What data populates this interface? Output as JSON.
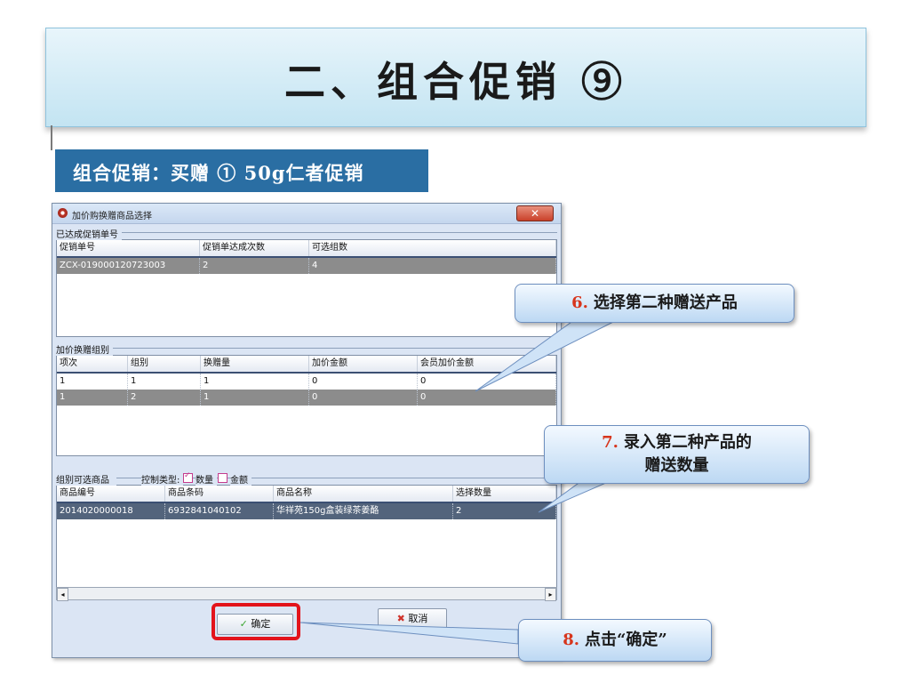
{
  "slide": {
    "title": "二、组合促销 ⑨",
    "subtitle": "组合促销：买赠 ① 50g仁者促销"
  },
  "dialog": {
    "title": "加价购换赠商品选择",
    "close_icon": "close-icon",
    "section1": {
      "label": "已达成促销单号",
      "headers": [
        "促销单号",
        "促销单达成次数",
        "可选组数"
      ],
      "rows": [
        [
          "ZCX-019000120723003",
          "2",
          "4"
        ]
      ]
    },
    "section2": {
      "label": "加价换赠组别",
      "headers": [
        "项次",
        "组别",
        "换赠量",
        "加价金额",
        "会员加价金额"
      ],
      "rows": [
        [
          "1",
          "1",
          "1",
          "0",
          "0"
        ],
        [
          "1",
          "2",
          "1",
          "0",
          "0"
        ]
      ]
    },
    "section3": {
      "label": "组别可选商品",
      "control_type_label": "控制类型:",
      "qty_label": "数量",
      "amount_label": "金额",
      "qty_checked": true,
      "amount_checked": false,
      "headers": [
        "商品编号",
        "商品条码",
        "商品名称",
        "选择数量"
      ],
      "rows": [
        [
          "2014020000018",
          "6932841040102",
          "华祥苑150g盒装绿茶姜酪",
          "2"
        ]
      ]
    },
    "ok_label": "确定",
    "cancel_label": "取消"
  },
  "callouts": {
    "c6": {
      "num": "6.",
      "text": "选择第二种赠送产品"
    },
    "c7": {
      "num": "7.",
      "line1": "录入第二种产品的",
      "line2": "赠送数量"
    },
    "c8": {
      "num": "8.",
      "text": "点击“确定”"
    }
  },
  "colors": {
    "accent_red": "#e3131b",
    "subtitle_bg": "#2a6ea3",
    "callout_number": "#d7351c"
  }
}
